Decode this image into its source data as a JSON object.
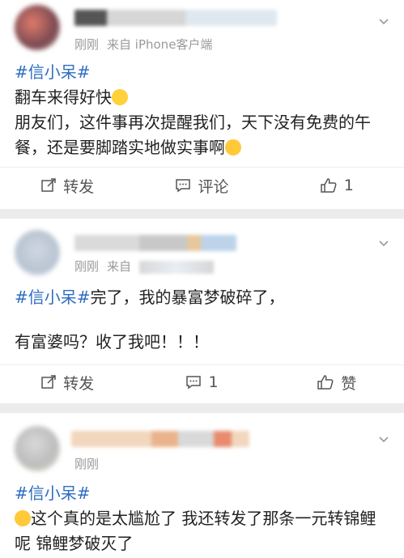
{
  "posts": [
    {
      "meta": {
        "time": "刚刚",
        "source": "来自 iPhone客户端"
      },
      "topic": "#信小呆#",
      "lines": [
        "翻车来得好快",
        "朋友们，这件事再次提醒我们，天下没有免费的午餐，还是要脚踏实地做实事啊"
      ],
      "actions": {
        "repost": "转发",
        "comment": "评论",
        "like": "1"
      }
    },
    {
      "meta": {
        "time": "刚刚",
        "source": "来自"
      },
      "topic": "#信小呆#",
      "lines": [
        "完了，我的暴富梦破碎了，",
        "有富婆吗？收了我吧！！！"
      ],
      "actions": {
        "repost": "转发",
        "comment": "1",
        "like": "赞"
      }
    },
    {
      "meta": {
        "time": "刚刚"
      },
      "topic": "#信小呆#",
      "lines": [
        "这个真的是太尴尬了 我还转发了那条一元转锦鲤呢 锦鲤梦破灭了"
      ]
    }
  ],
  "icons": {
    "repost": "share-edit-icon",
    "comment": "comment-icon",
    "like": "thumb-up-icon",
    "more": "chevron-down-icon",
    "emoji_surprise": "surprised-emoji-icon",
    "emoji_laugh_cry": "laugh-cry-emoji-icon"
  },
  "colors": {
    "topic": "#2f6ec0",
    "meta": "#9a9a9a",
    "background": "#ececec"
  }
}
